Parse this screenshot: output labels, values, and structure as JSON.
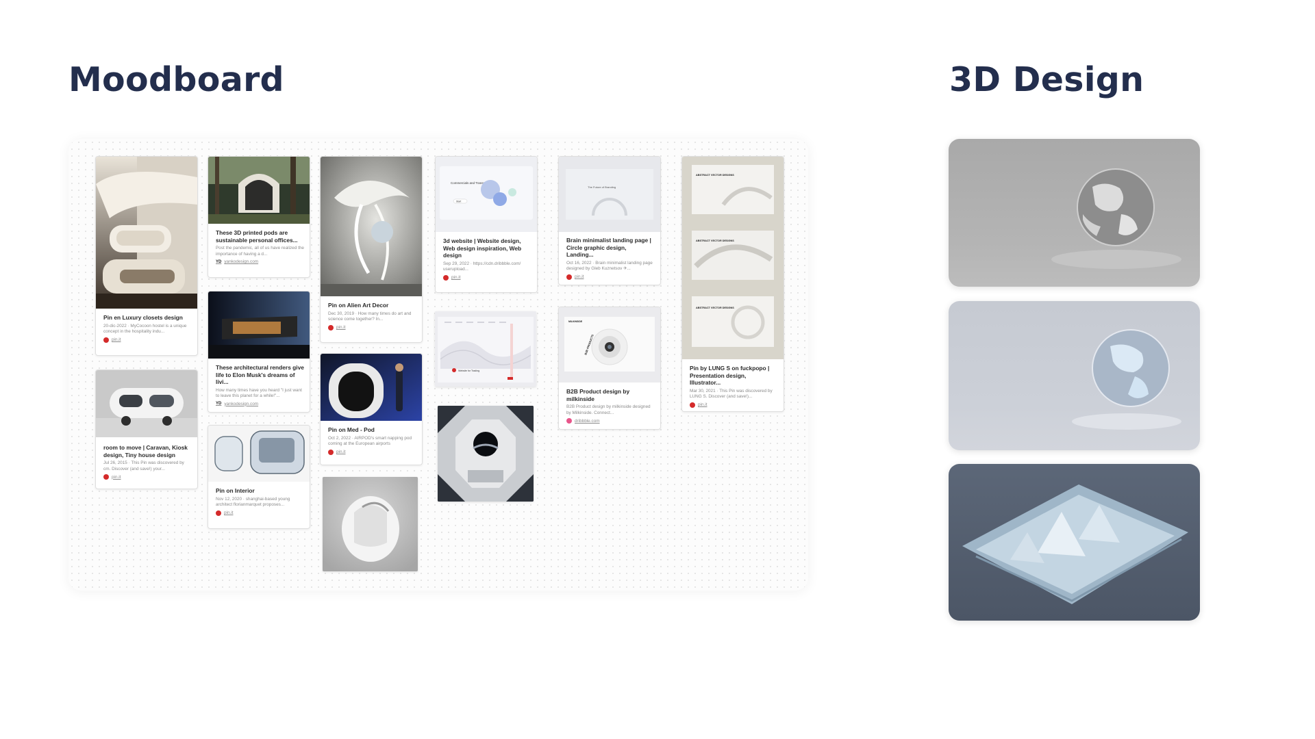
{
  "headings": {
    "moodboard": "Moodboard",
    "design3d": "3D Design"
  },
  "pins": {
    "c1": {
      "title": "Pin en Luxury closets design",
      "desc": "20-dic-2022 · MyCocoon hostel is a unique concept in the hospitality indu...",
      "source": "pin.it"
    },
    "c2": {
      "title": "room to move | Caravan, Kiosk design, Tiny house design",
      "desc": "Jul 26, 2015 · This Pin was discovered by cm. Discover (and save!) your...",
      "source": "pin.it"
    },
    "c3": {
      "title": "These 3D printed pods are sustainable personal offices...",
      "desc": "Post the pandemic, all of us have realized the importance of having a d...",
      "source": "yankodesign.com",
      "source_mark": "YD"
    },
    "c4": {
      "title": "These architectural renders give life to Elon Musk's dreams of livi...",
      "desc": "How many times have you heard \"I just want to leave this planet for a while!\"...",
      "source": "yankodesign.com",
      "source_mark": "YD"
    },
    "c5": {
      "title": "Pin on Interior",
      "desc": "Nov 12, 2020 · shanghai-based young architect florianmarquet proposes...",
      "source": "pin.it"
    },
    "c6": {
      "title": "Pin on Alien Art Decor",
      "desc": "Dec 30, 2019 · How many times do art and science come together? In...",
      "source": "pin.it"
    },
    "c7": {
      "title": "Pin on Med - Pod",
      "desc": "Oct 2, 2022 · AIRPOD's smart napping pod coming at the European airports",
      "source": "pin.it"
    },
    "c8": {
      "title": "3d website | Website design, Web design inspiration, Web design",
      "desc": "Sep 29, 2022 · https://cdn.dribbble.com/ userupload...",
      "source": "pin.it"
    },
    "c9": {
      "title": "Brain minimalist landing page | Circle graphic design, Landing...",
      "desc": "Oct 16, 2022 · Brain minimalist landing page designed by Gleb Kuznetsov ✈...",
      "source": "pin.it"
    },
    "c10": {
      "title": "B2B Product design by milkinside",
      "desc": "B2B Product design by milkinside designed by Milkinside. Connect...",
      "source": "dribbble.com"
    },
    "c11": {
      "title": "Pin by LUNG S on fuckpopo | Presentation design, Illustrator...",
      "desc": "Mar 30, 2021 · This Pin was discovered by LUNG S. Discover (and save!)...",
      "source": "pin.it"
    }
  },
  "mockups": {
    "web3d_hero": "Commercials and Transparency",
    "web3d_button": "Start",
    "brain_title": "The Future of Branding",
    "b2b_brand": "MILKINSIDE",
    "b2b_ring": "B2B PRODUCTS",
    "website_tagline": "Website for Trading",
    "abstract_heading": "ABSTRACT VECTOR DESIGNS"
  },
  "colors": {
    "heading": "#232e4d",
    "pin_red": "#d42a2a",
    "tile3_bg": "#4c5666"
  }
}
